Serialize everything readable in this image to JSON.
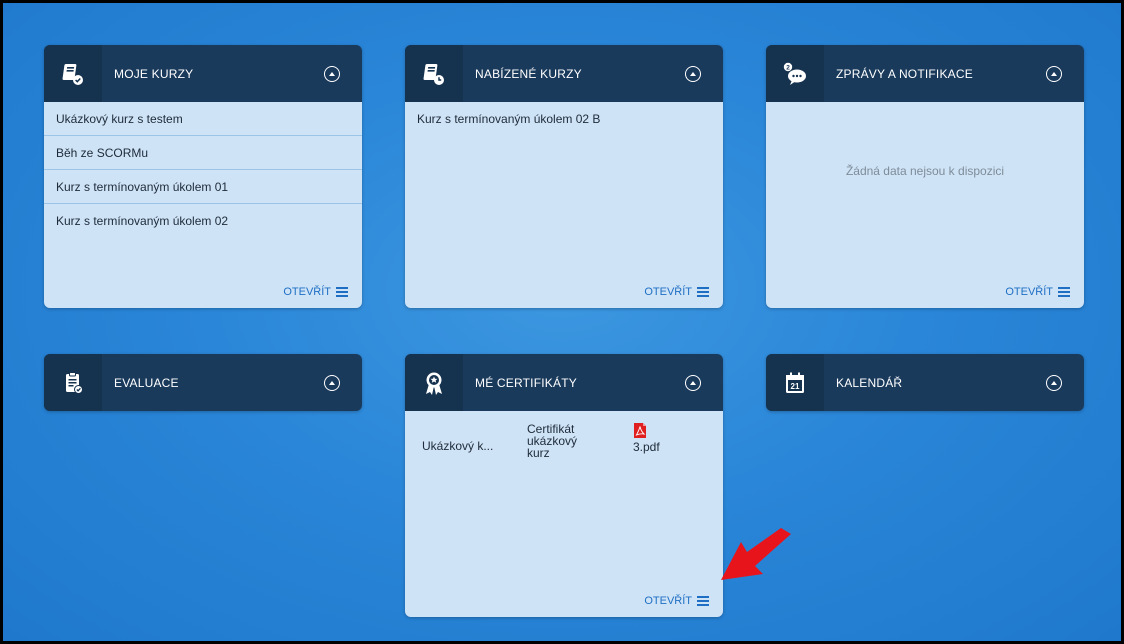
{
  "cards": {
    "moje_kurzy": {
      "title": "MOJE KURZY",
      "icon": "book-check-icon",
      "items": [
        "Ukázkový kurz s testem",
        "Běh ze SCORMu",
        "Kurz s termínovaným úkolem 01",
        "Kurz s termínovaným úkolem 02"
      ],
      "open_label": "OTEVŘÍT"
    },
    "nabizene_kurzy": {
      "title": "NABÍZENÉ KURZY",
      "icon": "book-clock-icon",
      "items": [
        "Kurz s termínovaným úkolem 02 B"
      ],
      "open_label": "OTEVŘÍT"
    },
    "zpravy": {
      "title": "ZPRÁVY A NOTIFIKACE",
      "icon": "chat-bubbles-icon",
      "badge": "2",
      "empty_message": "Žádná data nejsou k dispozici",
      "open_label": "OTEVŘÍT"
    },
    "evaluace": {
      "title": "EVALUACE",
      "icon": "clipboard-check-icon"
    },
    "certifikaty": {
      "title": "MÉ CERTIFIKÁTY",
      "icon": "award-ribbon-icon",
      "row": {
        "course": "Ukázkový k...",
        "certificate": "Certifikát ukázkový kurz",
        "file": "3.pdf"
      },
      "open_label": "OTEVŘÍT"
    },
    "kalendar": {
      "title": "KALENDÁŘ",
      "icon": "calendar-icon",
      "calendar_day": "21"
    }
  },
  "colors": {
    "header_bg": "#1a3a5c",
    "body_bg": "#cfe3f6",
    "link": "#1e6fc4",
    "annotation_arrow": "#e8141b"
  }
}
